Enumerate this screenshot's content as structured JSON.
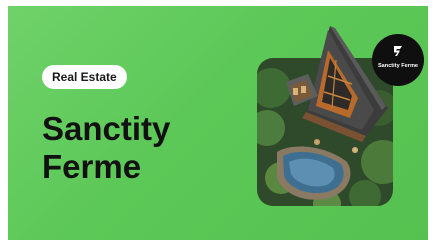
{
  "card": {
    "tag_label": "Real Estate",
    "title_line1": "Sanctity",
    "title_line2": "Ferme"
  },
  "badge": {
    "brand_name": "Sanctity Ferme",
    "logo_icon": "s-logo-icon"
  },
  "photo": {
    "subject": "house-photo"
  },
  "colors": {
    "background": "#5cc857",
    "badge": "#0f0f0f",
    "tag": "#ffffff",
    "title": "#111111"
  }
}
